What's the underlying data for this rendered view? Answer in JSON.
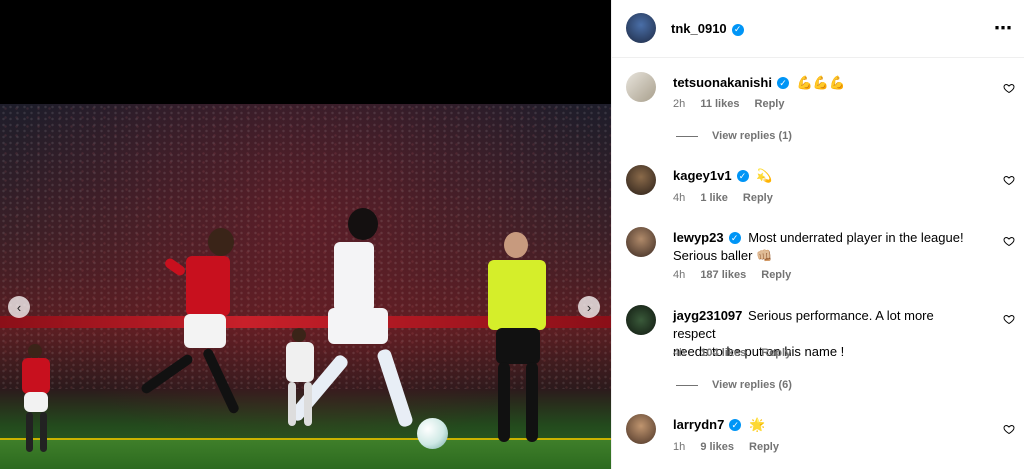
{
  "post": {
    "author": "tnk_0910",
    "more_icon": "⋯"
  },
  "media": {
    "prev_icon": "‹",
    "next_icon": "›"
  },
  "comments": [
    {
      "username": "tetsuonakanishi",
      "text": "💪💪💪",
      "time": "2h",
      "likes": "11 likes",
      "reply": "Reply",
      "view_replies": "View replies (1)"
    },
    {
      "username": "kagey1v1",
      "text": "💫",
      "time": "4h",
      "likes": "1 like",
      "reply": "Reply"
    },
    {
      "username": "lewyp23",
      "text_line1": "Most underrated player in the league!",
      "text_line2": "Serious baller 👊🏼",
      "time": "4h",
      "likes": "187 likes",
      "reply": "Reply"
    },
    {
      "username": "jayg231097",
      "text_line1": "Serious performance. A lot more respect",
      "text_line2": "needs to be put on his name !",
      "time": "4h",
      "likes": "104 likes",
      "reply": "Reply",
      "view_replies": "View replies (6)"
    },
    {
      "username": "larrydn7",
      "text": "🌟",
      "time": "1h",
      "likes": "9 likes",
      "reply": "Reply"
    }
  ],
  "colors": {
    "verified": "#0095f6",
    "meta_text": "#737373"
  }
}
